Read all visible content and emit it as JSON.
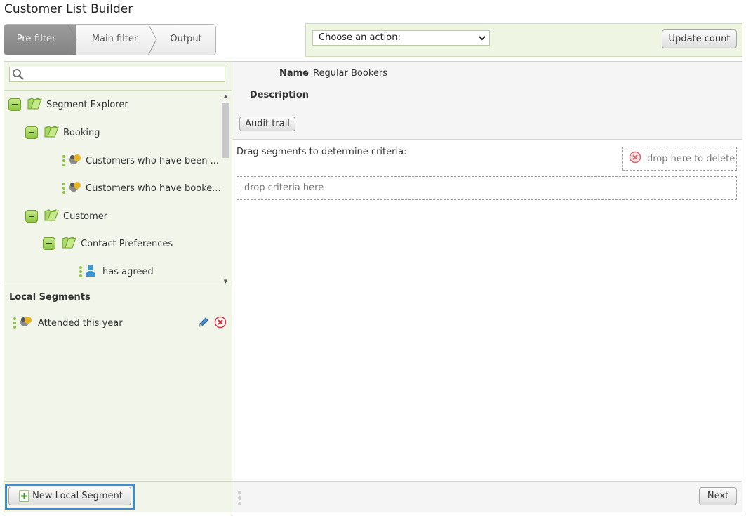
{
  "app": {
    "title": "Customer List Builder"
  },
  "wizard": {
    "steps": [
      {
        "label": "Pre-filter",
        "active": true
      },
      {
        "label": "Main filter",
        "active": false
      },
      {
        "label": "Output",
        "active": false
      }
    ]
  },
  "actions": {
    "select_value": "Choose an action:",
    "update_label": "Update count"
  },
  "search": {
    "value": "",
    "placeholder": ""
  },
  "tree": {
    "items": [
      {
        "label": "Segment Explorer",
        "kind": "folder",
        "level": 0
      },
      {
        "label": "Booking",
        "kind": "folder",
        "level": 1
      },
      {
        "label": "Customers who have been ...",
        "kind": "segment",
        "level": 2
      },
      {
        "label": "Customers who have booke...",
        "kind": "segment",
        "level": 2
      },
      {
        "label": "Customer",
        "kind": "folder",
        "level": 1
      },
      {
        "label": "Contact Preferences",
        "kind": "folder",
        "level": 2
      },
      {
        "label": "has agreed",
        "kind": "person",
        "level": 3
      }
    ]
  },
  "local_segments": {
    "title": "Local Segments",
    "items": [
      {
        "label": "Attended this year"
      }
    ]
  },
  "left_footer": {
    "new_segment_label": "New Local Segment"
  },
  "details": {
    "name_label": "Name",
    "name_value": "Regular Bookers",
    "description_label": "Description",
    "audit_label": "Audit trail"
  },
  "criteria": {
    "drag_title": "Drag segments to determine criteria:",
    "drop_delete": "drop here to delete",
    "drop_criteria": "drop criteria here"
  },
  "right_footer": {
    "next_label": "Next"
  },
  "colors": {
    "panel_green": "#f1f5ea",
    "accent_green": "#8cc63f",
    "active_step": "#8f8f8f",
    "highlight_blue": "#3d8ec9",
    "delete_red": "#d9333f"
  }
}
